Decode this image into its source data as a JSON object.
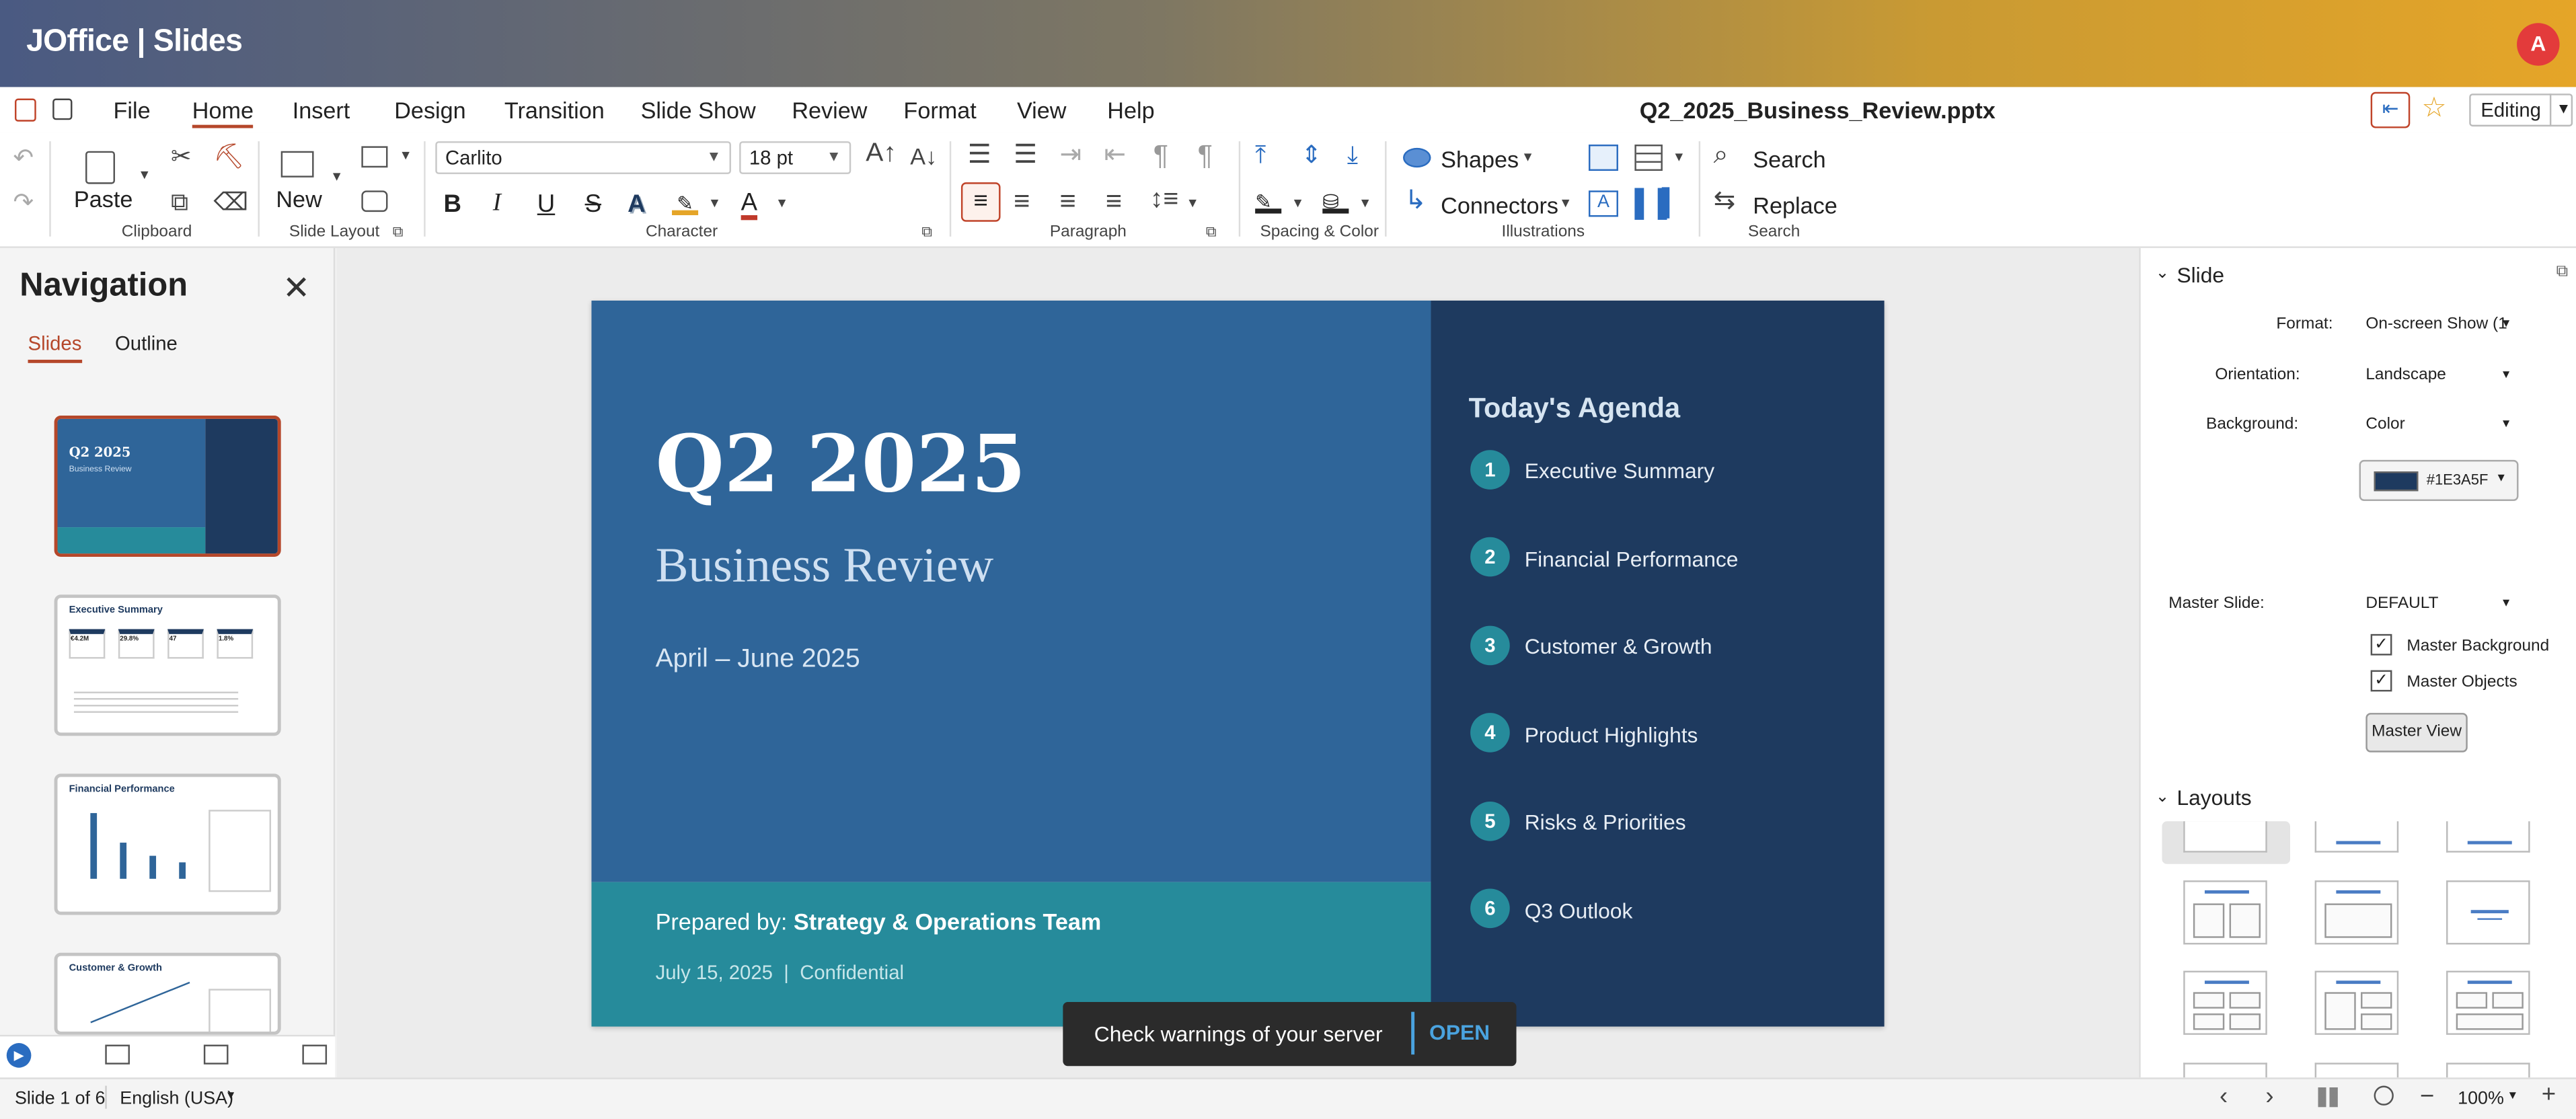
{
  "app": {
    "brand": "JOffice | Slides",
    "avatar_initial": "A",
    "document_name": "Q2_2025_Business_Review.pptx",
    "mode": "Editing"
  },
  "menu": {
    "file": "File",
    "home": "Home",
    "insert": "Insert",
    "design": "Design",
    "transition": "Transition",
    "slideshow": "Slide Show",
    "review": "Review",
    "format": "Format",
    "view": "View",
    "help": "Help"
  },
  "ribbon": {
    "paste": "Paste",
    "clipboard": "Clipboard",
    "new": "New",
    "slide_layout": "Slide Layout",
    "font_name": "Carlito",
    "font_size": "18 pt",
    "character": "Character",
    "paragraph": "Paragraph",
    "spacing_color": "Spacing & Color",
    "shapes": "Shapes",
    "connectors": "Connectors",
    "illustrations": "Illustrations",
    "search": "Search",
    "replace": "Replace",
    "search_group": "Search",
    "bold": "B",
    "italic": "I",
    "underline": "U",
    "strike": "S",
    "shadow": "A",
    "fontcolor": "A"
  },
  "navigation": {
    "title": "Navigation",
    "tab_slides": "Slides",
    "tab_outline": "Outline",
    "thumbs": [
      {
        "title": "Q2 2025",
        "sub": "Business Review"
      },
      {
        "title": "Executive Summary",
        "kpis": [
          "€4.2M",
          "29.8%",
          "47",
          "1.8%"
        ]
      },
      {
        "title": "Financial Performance"
      },
      {
        "title": "Customer & Growth"
      }
    ]
  },
  "slide": {
    "title": "Q2 2025",
    "subtitle": "Business Review",
    "date_range": "April – June 2025",
    "prepared_label": "Prepared by: ",
    "prepared_team": "Strategy & Operations Team",
    "footer_date": "July 15, 2025",
    "footer_sep": "|",
    "footer_conf": "Confidential",
    "agenda_title": "Today's Agenda",
    "agenda": [
      {
        "n": "1",
        "label": "Executive Summary"
      },
      {
        "n": "2",
        "label": "Financial Performance"
      },
      {
        "n": "3",
        "label": "Customer & Growth"
      },
      {
        "n": "4",
        "label": "Product Highlights"
      },
      {
        "n": "5",
        "label": "Risks & Priorities"
      },
      {
        "n": "6",
        "label": "Q3 Outlook"
      }
    ],
    "colors": {
      "left": "#2f6599",
      "bottom": "#268b9b",
      "right": "#1e3a5f"
    }
  },
  "toast": {
    "message": "Check warnings of your server",
    "action": "OPEN"
  },
  "sidebar": {
    "slide_section": "Slide",
    "format_label": "Format:",
    "format_value": "On-screen Show (1",
    "orientation_label": "Orientation:",
    "orientation_value": "Landscape",
    "background_label": "Background:",
    "background_value": "Color",
    "color_value": "#1E3A5F",
    "master_label": "Master Slide:",
    "master_value": "DEFAULT",
    "master_bg": "Master Background",
    "master_obj": "Master Objects",
    "master_view": "Master View",
    "layouts_section": "Layouts"
  },
  "status": {
    "slide_pos": "Slide 1 of 6",
    "language": "English (USA)",
    "zoom": "100%"
  }
}
